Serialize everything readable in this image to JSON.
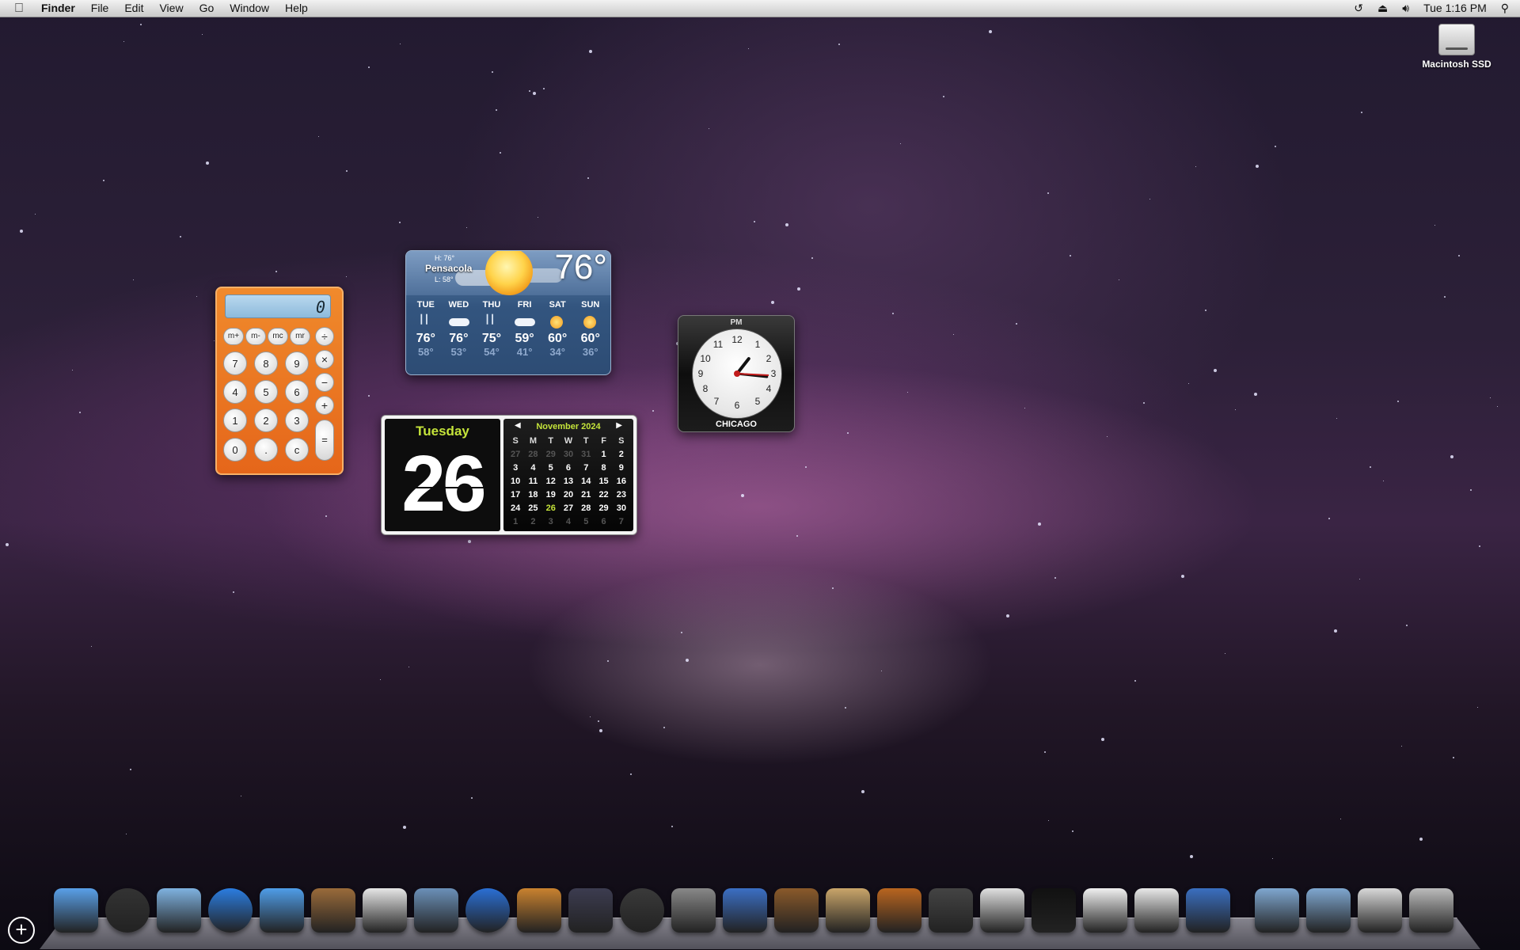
{
  "menubar": {
    "apple": "",
    "app_name": "Finder",
    "menus": [
      "File",
      "Edit",
      "View",
      "Go",
      "Window",
      "Help"
    ],
    "clock": "Tue 1:16 PM",
    "status_icons": [
      "time-machine-icon",
      "eject-icon",
      "volume-icon",
      "spotlight-icon"
    ]
  },
  "desktop": {
    "drive_label": "Macintosh SSD"
  },
  "calculator": {
    "display": "0",
    "memory_keys": [
      "m+",
      "m-",
      "mc",
      "mr"
    ],
    "keys": {
      "seven": "7",
      "eight": "8",
      "nine": "9",
      "four": "4",
      "five": "5",
      "six": "6",
      "one": "1",
      "two": "2",
      "three": "3",
      "zero": "0",
      "dot": ".",
      "clear": "c"
    },
    "ops": {
      "divide": "÷",
      "multiply": "×",
      "minus": "−",
      "plus": "+",
      "equals": "="
    }
  },
  "weather": {
    "high": "H: 76°",
    "city": "Pensacola",
    "low": "L: 58°",
    "current": "76°",
    "days": [
      {
        "name": "TUE",
        "icon": "rain",
        "high": "76°",
        "low": "58°"
      },
      {
        "name": "WED",
        "icon": "cloudy",
        "high": "76°",
        "low": "53°"
      },
      {
        "name": "THU",
        "icon": "rain",
        "high": "75°",
        "low": "54°"
      },
      {
        "name": "FRI",
        "icon": "cloudy",
        "high": "59°",
        "low": "41°"
      },
      {
        "name": "SAT",
        "icon": "sunny",
        "high": "60°",
        "low": "34°"
      },
      {
        "name": "SUN",
        "icon": "sunny",
        "high": "60°",
        "low": "36°"
      }
    ]
  },
  "clock": {
    "ampm": "PM",
    "city": "CHICAGO",
    "numbers": [
      "12",
      "1",
      "2",
      "3",
      "4",
      "5",
      "6",
      "7",
      "8",
      "9",
      "10",
      "11"
    ],
    "time": "1:16"
  },
  "calendar": {
    "weekday": "Tuesday",
    "day": "26",
    "month": "November 2024",
    "headers": [
      "S",
      "M",
      "T",
      "W",
      "T",
      "F",
      "S"
    ],
    "weeks": [
      [
        "27",
        "28",
        "29",
        "30",
        "31",
        "1",
        "2"
      ],
      [
        "3",
        "4",
        "5",
        "6",
        "7",
        "8",
        "9"
      ],
      [
        "10",
        "11",
        "12",
        "13",
        "14",
        "15",
        "16"
      ],
      [
        "17",
        "18",
        "19",
        "20",
        "21",
        "22",
        "23"
      ],
      [
        "24",
        "25",
        "26",
        "27",
        "28",
        "29",
        "30"
      ],
      [
        "1",
        "2",
        "3",
        "4",
        "5",
        "6",
        "7"
      ]
    ]
  },
  "dock": {
    "items": [
      "finder-icon",
      "dashboard-icon",
      "mail-icon",
      "safari-icon",
      "ichat-icon",
      "address-book-icon",
      "ical-icon",
      "iphoto-icon",
      "itunes-icon",
      "image-capture-icon",
      "expose-icon",
      "time-machine-icon",
      "system-preferences-icon",
      "xcode-icon",
      "garageband-icon",
      "preview-icon",
      "keynote-icon",
      "script-editor-icon",
      "textedit-icon",
      "terminal-icon",
      "pages-icon",
      "plist-editor-icon",
      "safari-dev-icon",
      "documents-folder-icon",
      "downloads-folder-icon",
      "applications-stack-icon",
      "trash-icon"
    ]
  },
  "colors": {
    "calendar_accent": "#c5e43a",
    "calculator_orange": "#e5661a"
  }
}
